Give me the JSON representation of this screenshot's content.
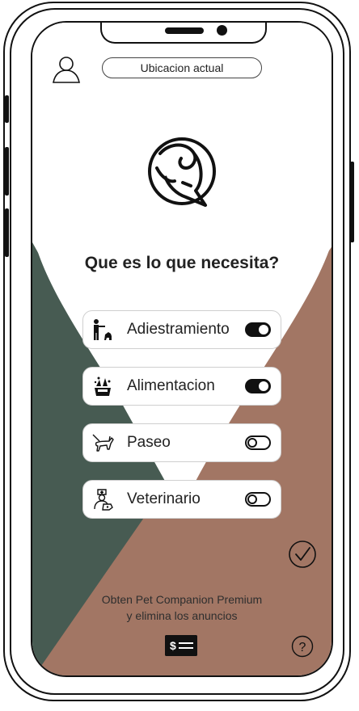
{
  "header": {
    "location_label": "Ubicacion actual"
  },
  "question": "Que es lo que necesita?",
  "options": [
    {
      "label": "Adiestramiento",
      "icon": "training-icon",
      "enabled": true
    },
    {
      "label": "Alimentacion",
      "icon": "food-icon",
      "enabled": true
    },
    {
      "label": "Paseo",
      "icon": "dog-walk-icon",
      "enabled": false
    },
    {
      "label": "Veterinario",
      "icon": "vet-icon",
      "enabled": false
    }
  ],
  "promo": {
    "line1": "Obten Pet Companion Premium",
    "line2": "y elimina los anuncios"
  },
  "colors": {
    "green": "#475b52",
    "brown": "#a27664",
    "text": "#222222"
  },
  "icons": {
    "avatar": "user-icon",
    "logo": "dog-logo-icon",
    "confirm": "check-icon",
    "payment": "payment-icon",
    "help": "help-icon"
  }
}
